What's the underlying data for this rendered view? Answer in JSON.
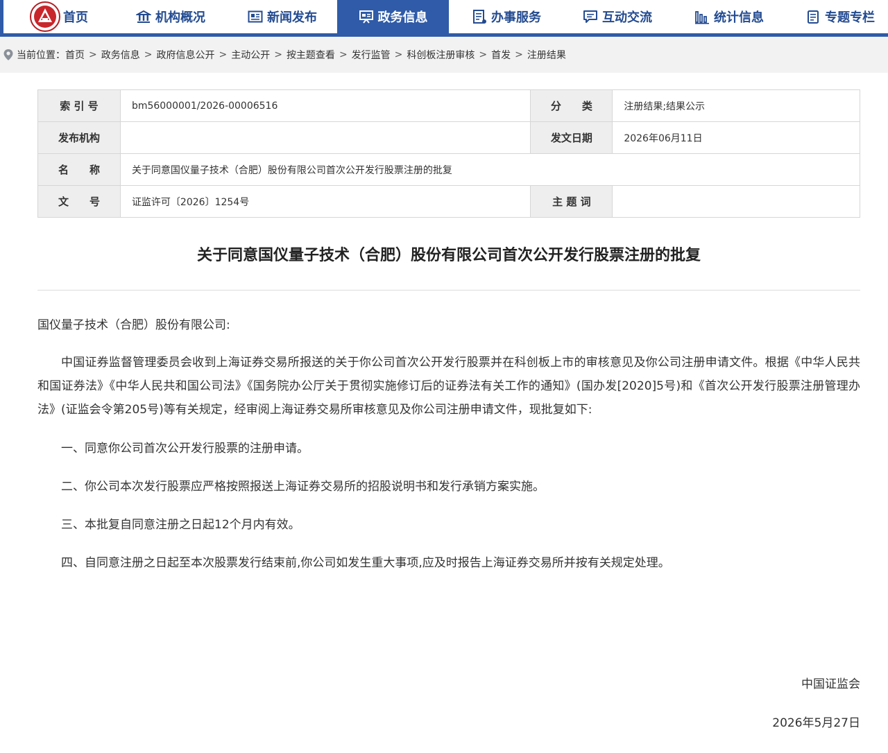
{
  "nav": {
    "items": [
      {
        "label": "首页",
        "icon": "emblem-logo",
        "active": false
      },
      {
        "label": "机构概况",
        "icon": "building-icon",
        "active": false
      },
      {
        "label": "新闻发布",
        "icon": "newspaper-icon",
        "active": false
      },
      {
        "label": "政务信息",
        "icon": "presentation-icon",
        "active": true
      },
      {
        "label": "办事服务",
        "icon": "document-list-icon",
        "active": false
      },
      {
        "label": "互动交流",
        "icon": "chat-icon",
        "active": false
      },
      {
        "label": "统计信息",
        "icon": "bar-chart-icon",
        "active": false
      },
      {
        "label": "专题专栏",
        "icon": "clipboard-icon",
        "active": false
      }
    ],
    "colors": {
      "primary": "#2f5ba8",
      "text": "#234b91"
    }
  },
  "breadcrumb": {
    "prefix": "当前位置：",
    "items": [
      "首页",
      "政务信息",
      "政府信息公开",
      "主动公开",
      "按主题查看",
      "发行监管",
      "科创板注册审核",
      "首发",
      "注册结果"
    ],
    "separator": ">"
  },
  "meta": {
    "index_label": "索 引 号",
    "index_value": "bm56000001/2026-00006516",
    "category_label": "分　　类",
    "category_value": "注册结果;结果公示",
    "issuer_label": "发布机构",
    "issuer_value": "",
    "date_label": "发文日期",
    "date_value": "2026年06月11日",
    "name_label": "名　　称",
    "name_value": "关于同意国仪量子技术（合肥）股份有限公司首次公开发行股票注册的批复",
    "docno_label": "文　　号",
    "docno_value": "证监许可〔2026〕1254号",
    "subject_label": "主 题 词",
    "subject_value": ""
  },
  "document": {
    "title": "关于同意国仪量子技术（合肥）股份有限公司首次公开发行股票注册的批复",
    "addressee": "国仪量子技术（合肥）股份有限公司:",
    "paragraph": "中国证券监督管理委员会收到上海证券交易所报送的关于你公司首次公开发行股票并在科创板上市的审核意见及你公司注册申请文件。根据《中华人民共和国证券法》《中华人民共和国公司法》《国务院办公厅关于贯彻实施修订后的证券法有关工作的通知》(国办发[2020]5号)和《首次公开发行股票注册管理办法》(证监会令第205号)等有关规定，经审阅上海证券交易所审核意见及你公司注册申请文件，现批复如下:",
    "items": [
      "一、同意你公司首次公开发行股票的注册申请。",
      "二、你公司本次发行股票应严格按照报送上海证券交易所的招股说明书和发行承销方案实施。",
      "三、本批复自同意注册之日起12个月内有效。",
      "四、自同意注册之日起至本次股票发行结束前,你公司如发生重大事项,应及时报告上海证券交易所并按有关规定处理。"
    ],
    "signature": "中国证监会",
    "date": "2026年5月27日"
  }
}
